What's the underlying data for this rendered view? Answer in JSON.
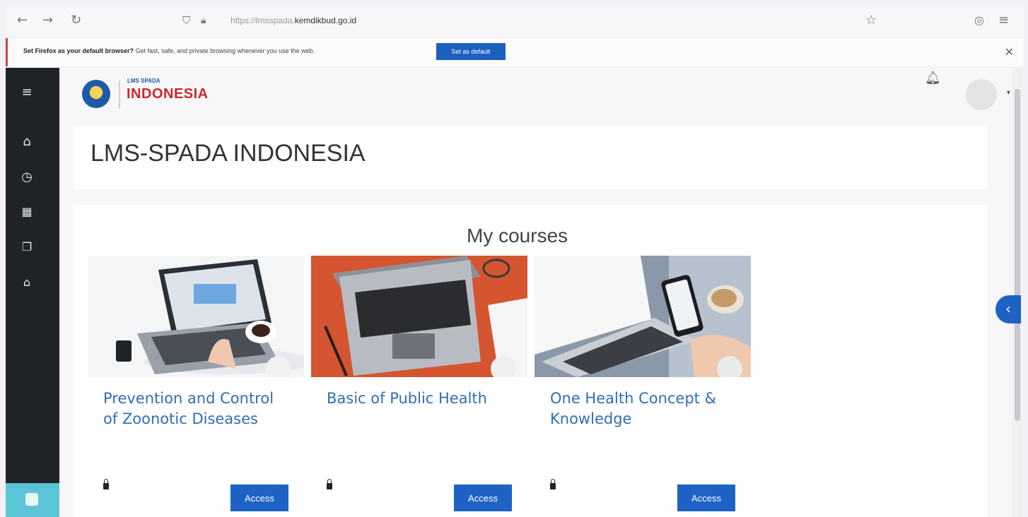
{
  "browser": {
    "url_prefix": "https://lmsspada.",
    "url_domain": "kemdikbud.go.id",
    "icons": [
      "back-icon",
      "forward-icon",
      "reload-icon",
      "shield-icon",
      "lock-icon",
      "star-icon",
      "account-icon",
      "menu-icon"
    ]
  },
  "notification": {
    "bold_text": "Set Firefox as your default browser?",
    "text": "Get fast, safe, and private browsing whenever you use the web.",
    "button_label": "Set as default",
    "close_glyph": "✕"
  },
  "rail": {
    "icons": [
      "hamburger-icon",
      "home-icon",
      "dashboard-icon",
      "calendar-icon",
      "files-icon",
      "courses-icon"
    ]
  },
  "header": {
    "logo_small": "LMS SPADA",
    "logo_big": "INDONESIA"
  },
  "page_title": "LMS-SPADA INDONESIA",
  "courses": {
    "heading": "My courses",
    "items": [
      {
        "title": "Prevention and Control of Zoonotic Diseases",
        "button": "Access"
      },
      {
        "title": "Basic of Public Health",
        "button": "Access"
      },
      {
        "title": "One Health Concept & Knowledge",
        "button": "Access"
      }
    ]
  },
  "colors": {
    "accent": "#1e63c4",
    "course_title": "#2f6fb5",
    "rail": "#1f2326",
    "logo_red": "#c92a2a"
  }
}
